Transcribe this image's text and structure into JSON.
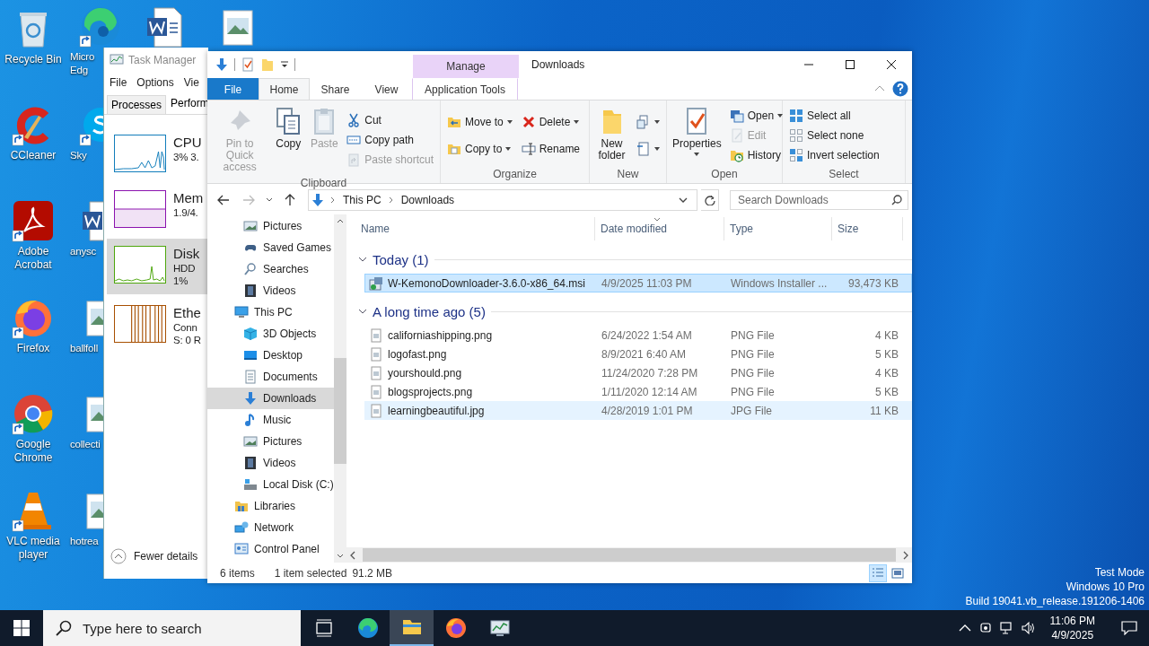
{
  "desktop": {
    "icons": [
      {
        "label": "Recycle Bin",
        "kind": "recycle",
        "shortcut": false
      },
      {
        "label": "CCleaner",
        "kind": "ccleaner",
        "shortcut": true
      },
      {
        "label": "Adobe\nAcrobat",
        "kind": "acrobat",
        "shortcut": true
      },
      {
        "label": "Firefox",
        "kind": "firefox",
        "shortcut": true
      },
      {
        "label": "Google\nChrome",
        "kind": "chrome",
        "shortcut": true
      },
      {
        "label": "VLC media\nplayer",
        "kind": "vlc",
        "shortcut": true
      }
    ],
    "partial_icons": [
      {
        "label": "Micro\nEdg",
        "kind": "edge",
        "shortcut": true,
        "covered": false
      },
      {
        "label": "Sky",
        "kind": "skype",
        "shortcut": true,
        "covered": true
      },
      {
        "label": "anysc",
        "kind": "word",
        "shortcut": false,
        "covered": true
      },
      {
        "label": "ballfoll",
        "kind": "image",
        "shortcut": false,
        "covered": true
      },
      {
        "label": "collecti",
        "kind": "image",
        "shortcut": false,
        "covered": true
      },
      {
        "label": "hotrea",
        "kind": "image",
        "shortcut": false,
        "covered": true
      }
    ],
    "top_icons": [
      {
        "kind": "word"
      },
      {
        "kind": "image"
      }
    ],
    "system_text": [
      "Test Mode",
      "Windows 10 Pro",
      "Build 19041.vb_release.191206-1406"
    ]
  },
  "task_manager": {
    "title": "Task Manager",
    "menu": [
      "File",
      "Options",
      "Vie"
    ],
    "tabs": [
      {
        "label": "Processes",
        "selected": false
      },
      {
        "label": "Perform",
        "selected": true
      }
    ],
    "resources": [
      {
        "kind": "cpu",
        "name": "CPU",
        "lines": [
          "3% 3."
        ],
        "color": "#117dbb",
        "selected": false
      },
      {
        "kind": "memory",
        "name": "Mem",
        "lines": [
          "1.9/4."
        ],
        "color": "#8b12ae",
        "selected": false
      },
      {
        "kind": "disk",
        "name": "Disk",
        "lines": [
          "HDD",
          "1%"
        ],
        "color": "#4da60c",
        "selected": true
      },
      {
        "kind": "ethernet",
        "name": "Ethe",
        "lines": [
          "Conn",
          "S: 0 R"
        ],
        "color": "#a74f01",
        "selected": false
      }
    ],
    "footer": "Fewer details"
  },
  "explorer": {
    "title": "Downloads",
    "context_group": "Manage",
    "tabs": [
      {
        "label": "File",
        "kind": "file",
        "selected": false
      },
      {
        "label": "Home",
        "kind": "plain",
        "selected": true
      },
      {
        "label": "Share",
        "kind": "plain",
        "selected": false
      },
      {
        "label": "View",
        "kind": "plain",
        "selected": false
      },
      {
        "label": "Application Tools",
        "kind": "context",
        "selected": false
      }
    ],
    "ribbon": [
      {
        "label": "Clipboard",
        "columns": [
          {
            "kind": "large",
            "buttons": [
              {
                "label": "Pin to Quick access",
                "kind": "pin",
                "disabled": true,
                "dropdown": false
              }
            ]
          },
          {
            "kind": "large",
            "buttons": [
              {
                "label": "Copy",
                "kind": "copy",
                "disabled": false,
                "dropdown": false
              }
            ]
          },
          {
            "kind": "large",
            "buttons": [
              {
                "label": "Paste",
                "kind": "paste",
                "disabled": true,
                "dropdown": false
              }
            ]
          },
          {
            "kind": "stack",
            "buttons": [
              {
                "label": "Cut",
                "kind": "cut",
                "disabled": false,
                "dropdown": false
              },
              {
                "label": "Copy path",
                "kind": "copy-path",
                "disabled": false,
                "dropdown": false
              },
              {
                "label": "Paste shortcut",
                "kind": "paste-shortcut",
                "disabled": true,
                "dropdown": false
              }
            ]
          }
        ]
      },
      {
        "label": "Organize",
        "columns": [
          {
            "kind": "stack",
            "buttons": [
              {
                "label": "Move to",
                "kind": "move-to",
                "disabled": false,
                "dropdown": true
              },
              {
                "label": "Copy to",
                "kind": "copy-to",
                "disabled": false,
                "dropdown": true
              }
            ]
          },
          {
            "kind": "stack",
            "buttons": [
              {
                "label": "Delete",
                "kind": "delete",
                "disabled": false,
                "dropdown": true
              },
              {
                "label": "Rename",
                "kind": "rename",
                "disabled": false,
                "dropdown": false
              }
            ]
          }
        ]
      },
      {
        "label": "New",
        "columns": [
          {
            "kind": "large",
            "buttons": [
              {
                "label": "New folder",
                "kind": "new-folder",
                "disabled": false,
                "dropdown": false
              }
            ]
          },
          {
            "kind": "stack",
            "buttons": [
              {
                "kind": "new-item",
                "disabled": false,
                "dropdown": true
              },
              {
                "kind": "easy-access",
                "disabled": false,
                "dropdown": true
              }
            ]
          }
        ]
      },
      {
        "label": "Open",
        "columns": [
          {
            "kind": "large",
            "buttons": [
              {
                "label": "Properties",
                "kind": "properties",
                "disabled": false,
                "dropdown": true
              }
            ]
          },
          {
            "kind": "stack",
            "buttons": [
              {
                "label": "Open",
                "kind": "open",
                "disabled": false,
                "dropdown": true
              },
              {
                "label": "Edit",
                "kind": "edit",
                "disabled": true,
                "dropdown": false
              },
              {
                "label": "History",
                "kind": "history",
                "disabled": false,
                "dropdown": false
              }
            ]
          }
        ]
      },
      {
        "label": "Select",
        "columns": [
          {
            "kind": "stack",
            "buttons": [
              {
                "label": "Select all",
                "kind": "select-all",
                "disabled": false,
                "dropdown": false
              },
              {
                "label": "Select none",
                "kind": "select-none",
                "disabled": false,
                "dropdown": false
              },
              {
                "label": "Invert selection",
                "kind": "invert",
                "disabled": false,
                "dropdown": false
              }
            ]
          }
        ]
      }
    ],
    "address": {
      "path": [
        "This PC",
        "Downloads"
      ]
    },
    "search": {
      "placeholder": "Search Downloads"
    },
    "nav_pane": {
      "leading_items": [
        {
          "label": "Pictures",
          "kind": "pictures",
          "selected": false
        },
        {
          "label": "Saved Games",
          "kind": "games",
          "selected": false
        },
        {
          "label": "Searches",
          "kind": "searches",
          "selected": false
        },
        {
          "label": "Videos",
          "kind": "videos",
          "selected": false
        }
      ],
      "items": [
        {
          "label": "This PC",
          "kind": "pc",
          "selected": false,
          "children": [
            {
              "label": "3D Objects",
              "kind": "objects",
              "selected": false
            },
            {
              "label": "Desktop",
              "kind": "desktop",
              "selected": false
            },
            {
              "label": "Documents",
              "kind": "documents",
              "selected": false
            },
            {
              "label": "Downloads",
              "kind": "downloads",
              "selected": true
            },
            {
              "label": "Music",
              "kind": "music",
              "selected": false
            },
            {
              "label": "Pictures",
              "kind": "pictures",
              "selected": false
            },
            {
              "label": "Videos",
              "kind": "videos",
              "selected": false
            },
            {
              "label": "Local Disk (C:)",
              "kind": "disk",
              "selected": false
            }
          ]
        },
        {
          "label": "Libraries",
          "kind": "libraries",
          "selected": false
        },
        {
          "label": "Network",
          "kind": "network",
          "selected": false
        },
        {
          "label": "Control Panel",
          "kind": "control-panel",
          "selected": false
        }
      ]
    },
    "columns": [
      {
        "label": "Name",
        "sorted": false
      },
      {
        "label": "Date modified",
        "sorted": true
      },
      {
        "label": "Type",
        "sorted": false
      },
      {
        "label": "Size",
        "sorted": false
      }
    ],
    "groups": [
      {
        "title": "Today (1)",
        "expanded": true,
        "files": [
          {
            "name": "W-KemonoDownloader-3.6.0-x86_64.msi",
            "date": "4/9/2025 11:03 PM",
            "type": "Windows Installer ...",
            "size": "93,473 KB",
            "kind": "installer",
            "selected": true,
            "hovered": false
          }
        ]
      },
      {
        "title": "A long time ago (5)",
        "expanded": true,
        "files": [
          {
            "name": "californiashipping.png",
            "date": "6/24/2022 1:54 AM",
            "type": "PNG File",
            "size": "4 KB",
            "kind": "image",
            "selected": false,
            "hovered": false
          },
          {
            "name": "logofast.png",
            "date": "8/9/2021 6:40 AM",
            "type": "PNG File",
            "size": "5 KB",
            "kind": "image",
            "selected": false,
            "hovered": false
          },
          {
            "name": "yourshould.png",
            "date": "11/24/2020 7:28 PM",
            "type": "PNG File",
            "size": "4 KB",
            "kind": "image",
            "selected": false,
            "hovered": false
          },
          {
            "name": "blogsprojects.png",
            "date": "1/11/2020 12:14 AM",
            "type": "PNG File",
            "size": "5 KB",
            "kind": "image",
            "selected": false,
            "hovered": false
          },
          {
            "name": "learningbeautiful.jpg",
            "date": "4/28/2019 1:01 PM",
            "type": "JPG File",
            "size": "11 KB",
            "kind": "image",
            "selected": false,
            "hovered": true
          }
        ]
      }
    ],
    "status": {
      "count": "6 items",
      "selection": "1 item selected",
      "size": "91.2 MB"
    },
    "views": [
      {
        "kind": "details",
        "selected": true
      },
      {
        "kind": "large-icons",
        "selected": false
      }
    ]
  },
  "taskbar": {
    "search_placeholder": "Type here to search",
    "apps": [
      {
        "kind": "task-view",
        "active": false
      },
      {
        "kind": "edge",
        "active": false
      },
      {
        "kind": "explorer",
        "active": true
      },
      {
        "kind": "firefox",
        "active": false
      },
      {
        "kind": "task-manager",
        "active": false
      }
    ],
    "time": "11:06 PM",
    "date": "4/9/2025"
  }
}
